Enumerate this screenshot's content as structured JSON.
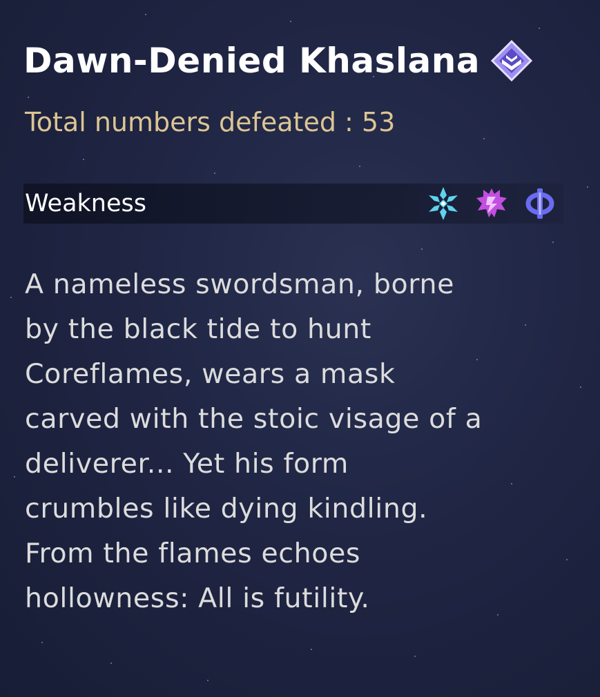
{
  "enemy": {
    "name": "Dawn-Denied Khaslana",
    "rank_icon": "elite-rank-icon",
    "defeated_text": "Total numbers defeated : 53"
  },
  "weakness": {
    "label": "Weakness",
    "icons": [
      {
        "name": "ice-element-icon",
        "color": "#5fd3ee"
      },
      {
        "name": "lightning-element-icon",
        "color": "#c24fe0"
      },
      {
        "name": "imaginary-element-icon",
        "color": "#6a6cf0"
      }
    ]
  },
  "description": "A nameless swordsman, borne\nby the black tide to hunt\nCoreflames, wears a mask\ncarved with the stoic visage of a\ndeliverer... Yet his form\ncrumbles like dying kindling.\n From the flames echoes\nhollowness: All is futility.",
  "colors": {
    "background": "#1f2543",
    "title": "#ffffff",
    "defeated": "#dcc594",
    "body_text": "#dcdcdc"
  }
}
